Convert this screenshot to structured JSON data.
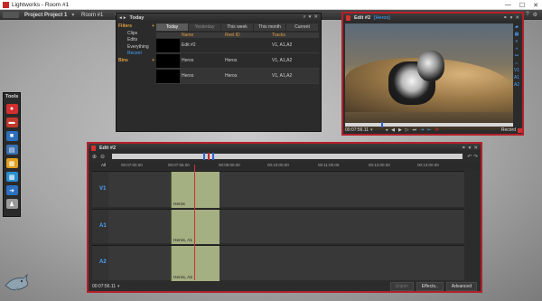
{
  "window": {
    "title": "Lightworks - Room #1",
    "controls": [
      "—",
      "☐",
      "✕"
    ]
  },
  "app_bar": {
    "project": "Project Project 1",
    "room": "Room #1"
  },
  "tools": {
    "title": "Tools",
    "items": [
      {
        "name": "record-tool",
        "color": "#d32f2f",
        "glyph": "●"
      },
      {
        "name": "import-tool",
        "color": "#c0392b",
        "glyph": "▬"
      },
      {
        "name": "projects-tool",
        "color": "#2b6fbf",
        "glyph": "■"
      },
      {
        "name": "log-tool",
        "color": "#3a6fb0",
        "glyph": "▤"
      },
      {
        "name": "search-tool",
        "color": "#e0a020",
        "glyph": "▦"
      },
      {
        "name": "bin-tool",
        "color": "#2a8fd0",
        "glyph": "▩"
      },
      {
        "name": "export-tool",
        "color": "#2b6fbf",
        "glyph": "➜"
      },
      {
        "name": "users-tool",
        "color": "#999999",
        "glyph": "♟"
      }
    ]
  },
  "search": {
    "header_title": "Today",
    "filters": {
      "heading": "Filters",
      "items": [
        "Clips",
        "Edits",
        "Everything",
        "Recent"
      ],
      "bins_heading": "Bins"
    },
    "date_tabs": [
      "Today",
      "Yesterday",
      "This week",
      "This month",
      "Current"
    ],
    "columns": [
      "Name",
      "Reel ID",
      "Tracks"
    ],
    "rows": [
      {
        "name": "Edit #2",
        "reel": "",
        "tracks": "V1, A1,A2"
      },
      {
        "name": "Heros",
        "reel": "Heros",
        "tracks": "V1, A1,A2"
      },
      {
        "name": "Heros",
        "reel": "Heros",
        "tracks": "V1, A1,A2"
      }
    ]
  },
  "viewer": {
    "title": "Edit #2",
    "subtitle": "[Heros]",
    "timecode": "00:07:56.11",
    "record_label": "Record",
    "side_tracks": [
      "V1",
      "A1",
      "A2"
    ]
  },
  "editor": {
    "title": "Edit #2",
    "ruler_audio_label": "All",
    "ruler_ticks": [
      "00:07:00.00",
      "00:07:56.00",
      "00:09:00.00",
      "00:10:00.00",
      "00:11:00.00",
      "00:12:00.00",
      "00:13:00.00"
    ],
    "tracks": [
      {
        "id": "V1",
        "clip": "Heros"
      },
      {
        "id": "A1",
        "clip": "Heros, A1"
      },
      {
        "id": "A2",
        "clip": "Heros, A2"
      }
    ],
    "timecode": "00:07:56.11",
    "buttons": {
      "unjoin": "Unjoin",
      "effects": "Effects..",
      "advanced": "Advanced"
    }
  },
  "colors": {
    "accent_red": "#b4202a",
    "accent_blue": "#4aa3ff",
    "clip_green": "#a4af82"
  }
}
